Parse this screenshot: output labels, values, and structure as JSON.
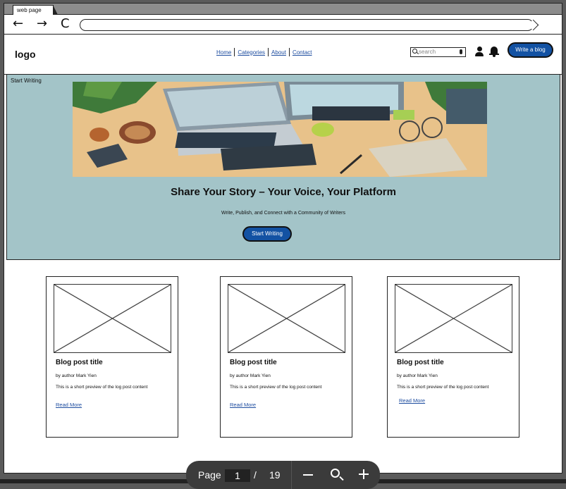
{
  "browser": {
    "tab_label": "web page",
    "back_icon": "←",
    "forward_icon": "→",
    "reload_icon": "C"
  },
  "header": {
    "logo": "logo",
    "nav": [
      "Home",
      "Categories",
      "About",
      "Contact"
    ],
    "search_placeholder": "search",
    "write_button": "Write a blog"
  },
  "hero": {
    "tag": "Start Writing",
    "title": "Share Your Story – Your Voice, Your Platform",
    "subtitle": "Write, Publish, and Connect with a Community of Writers",
    "button": "Start Writing"
  },
  "cards": [
    {
      "title": "Blog post title",
      "author": "by author Mark Yien",
      "preview": "This is a short preview of the log post content",
      "link": "Read More"
    },
    {
      "title": "Blog post title",
      "author": "by author Mark Yien",
      "preview": "This is a short preview of the log post content",
      "link": "Read More"
    },
    {
      "title": "Blog post title",
      "author": "by author Mark Yien",
      "preview": "This is a short preview of the log post content",
      "link": "Read More"
    }
  ],
  "pdf_toolbar": {
    "page_label": "Page",
    "current_page": "1",
    "separator": "/",
    "total_pages": "19"
  },
  "colors": {
    "accent": "#1352a3",
    "hero_bg": "#a3c4c8",
    "link": "#1f4ea0"
  }
}
